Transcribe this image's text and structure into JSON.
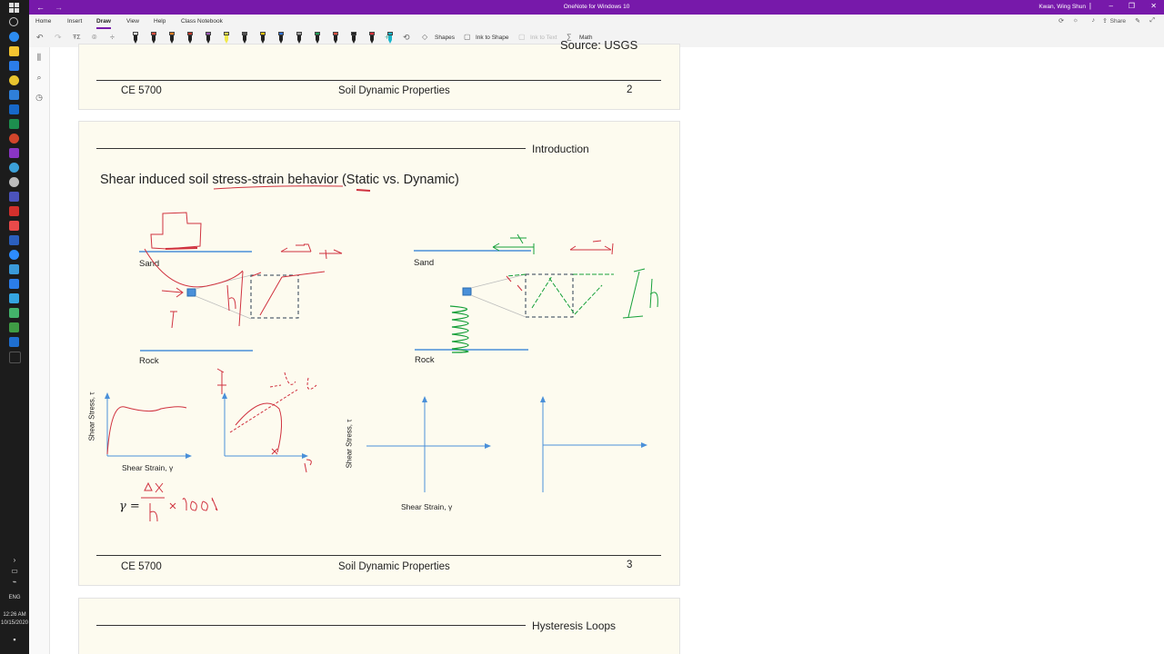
{
  "window": {
    "title": "OneNote for Windows 10",
    "user": "Kwan, Wing Shun"
  },
  "ribbon": {
    "tabs": [
      "Home",
      "Insert",
      "Draw",
      "View",
      "Help",
      "Class Notebook"
    ],
    "active_tab": "Draw",
    "share_label": "Share"
  },
  "toolbar": {
    "shapes_label": "Shapes",
    "ink_to_shape_label": "Ink to Shape",
    "ink_to_text_label": "Ink to Text",
    "math_label": "Math",
    "pens": [
      {
        "color": "#ffffff",
        "type": "pen"
      },
      {
        "color": "#e74c3c",
        "type": "pen"
      },
      {
        "color": "#e67e22",
        "type": "pen"
      },
      {
        "color": "#c0392b",
        "type": "pen"
      },
      {
        "color": "#9b59b6",
        "type": "pen"
      },
      {
        "color": "#f1e94b",
        "type": "highlighter"
      },
      {
        "color": "#555555",
        "type": "pen"
      },
      {
        "color": "#f2c200",
        "type": "pen"
      },
      {
        "color": "#2f6fd1",
        "type": "pen"
      },
      {
        "color": "#a0a0a0",
        "type": "pen"
      },
      {
        "color": "#1f9d55",
        "type": "pen"
      },
      {
        "color": "#e74c3c",
        "type": "pen"
      },
      {
        "color": "#222222",
        "type": "pen"
      },
      {
        "color": "#d9303a",
        "type": "pen"
      },
      {
        "color": "#19b5c9",
        "type": "highlighter"
      }
    ]
  },
  "taskbar": {
    "time": "12:26 AM",
    "date": "10/15/2020",
    "language": "ENG"
  },
  "page": {
    "slide2": {
      "partial_text": "Source: USGS",
      "course": "CE 5700",
      "title": "Soil Dynamic Properties",
      "number": "2"
    },
    "slide3": {
      "section": "Introduction",
      "heading": "Shear induced soil stress-strain behavior (Static vs. Dynamic)",
      "sand_label_left": "Sand",
      "sand_label_right": "Sand",
      "rock_label_left": "Rock",
      "rock_label_right": "Rock",
      "y_axis_label_left": "Shear Stress, τ",
      "x_axis_label_left": "Shear Strain, γ",
      "y_axis_label_right": "Shear Stress, τ",
      "x_axis_label_right": "Shear Strain, γ",
      "formula_lhs": "γ =",
      "course": "CE 5700",
      "title": "Soil Dynamic Properties",
      "number": "3"
    },
    "slide4": {
      "section": "Hysteresis Loops"
    }
  },
  "colors": {
    "onenote_purple": "#7719aa",
    "slide_bg": "#fdfbef",
    "ink_red": "#d0323f",
    "ink_green": "#16a03a",
    "ground_blue": "#4a90d9"
  }
}
